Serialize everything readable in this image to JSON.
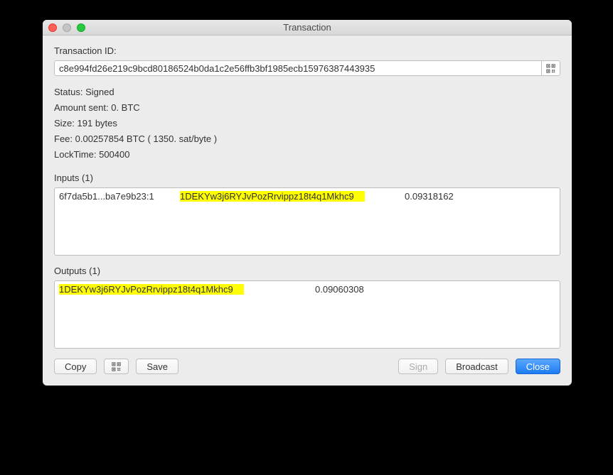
{
  "window": {
    "title": "Transaction"
  },
  "txid": {
    "label": "Transaction ID:",
    "value": "c8e994fd26e219c9bcd80186524b0da1c2e56ffb3bf1985ecb15976387443935"
  },
  "info": {
    "status": "Status: Signed",
    "amount": "Amount sent: 0. BTC",
    "size": "Size: 191 bytes",
    "fee": "Fee: 0.00257854 BTC  ( 1350. sat/byte )",
    "locktime": "LockTime: 500400"
  },
  "inputs": {
    "label": "Inputs (1)",
    "rows": [
      {
        "prevout": "6f7da5b1...ba7e9b23:1",
        "address": "1DEKYw3j6RYJvPozRrvippz18t4q1Mkhc9",
        "amount": "0.09318162"
      }
    ]
  },
  "outputs": {
    "label": "Outputs (1)",
    "rows": [
      {
        "address": "1DEKYw3j6RYJvPozRrvippz18t4q1Mkhc9",
        "amount": "0.09060308"
      }
    ]
  },
  "buttons": {
    "copy": "Copy",
    "save": "Save",
    "sign": "Sign",
    "broadcast": "Broadcast",
    "close": "Close"
  }
}
